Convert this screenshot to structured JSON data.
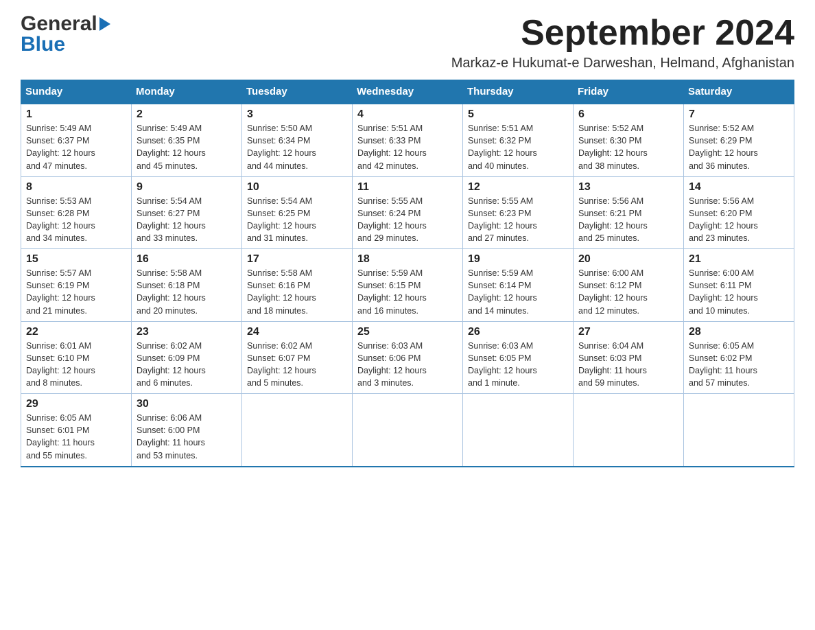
{
  "header": {
    "logo_line1": "General",
    "logo_line2": "Blue",
    "title": "September 2024",
    "subtitle": "Markaz-e Hukumat-e Darweshan, Helmand, Afghanistan"
  },
  "weekdays": [
    "Sunday",
    "Monday",
    "Tuesday",
    "Wednesday",
    "Thursday",
    "Friday",
    "Saturday"
  ],
  "weeks": [
    [
      {
        "day": "1",
        "info": "Sunrise: 5:49 AM\nSunset: 6:37 PM\nDaylight: 12 hours\nand 47 minutes."
      },
      {
        "day": "2",
        "info": "Sunrise: 5:49 AM\nSunset: 6:35 PM\nDaylight: 12 hours\nand 45 minutes."
      },
      {
        "day": "3",
        "info": "Sunrise: 5:50 AM\nSunset: 6:34 PM\nDaylight: 12 hours\nand 44 minutes."
      },
      {
        "day": "4",
        "info": "Sunrise: 5:51 AM\nSunset: 6:33 PM\nDaylight: 12 hours\nand 42 minutes."
      },
      {
        "day": "5",
        "info": "Sunrise: 5:51 AM\nSunset: 6:32 PM\nDaylight: 12 hours\nand 40 minutes."
      },
      {
        "day": "6",
        "info": "Sunrise: 5:52 AM\nSunset: 6:30 PM\nDaylight: 12 hours\nand 38 minutes."
      },
      {
        "day": "7",
        "info": "Sunrise: 5:52 AM\nSunset: 6:29 PM\nDaylight: 12 hours\nand 36 minutes."
      }
    ],
    [
      {
        "day": "8",
        "info": "Sunrise: 5:53 AM\nSunset: 6:28 PM\nDaylight: 12 hours\nand 34 minutes."
      },
      {
        "day": "9",
        "info": "Sunrise: 5:54 AM\nSunset: 6:27 PM\nDaylight: 12 hours\nand 33 minutes."
      },
      {
        "day": "10",
        "info": "Sunrise: 5:54 AM\nSunset: 6:25 PM\nDaylight: 12 hours\nand 31 minutes."
      },
      {
        "day": "11",
        "info": "Sunrise: 5:55 AM\nSunset: 6:24 PM\nDaylight: 12 hours\nand 29 minutes."
      },
      {
        "day": "12",
        "info": "Sunrise: 5:55 AM\nSunset: 6:23 PM\nDaylight: 12 hours\nand 27 minutes."
      },
      {
        "day": "13",
        "info": "Sunrise: 5:56 AM\nSunset: 6:21 PM\nDaylight: 12 hours\nand 25 minutes."
      },
      {
        "day": "14",
        "info": "Sunrise: 5:56 AM\nSunset: 6:20 PM\nDaylight: 12 hours\nand 23 minutes."
      }
    ],
    [
      {
        "day": "15",
        "info": "Sunrise: 5:57 AM\nSunset: 6:19 PM\nDaylight: 12 hours\nand 21 minutes."
      },
      {
        "day": "16",
        "info": "Sunrise: 5:58 AM\nSunset: 6:18 PM\nDaylight: 12 hours\nand 20 minutes."
      },
      {
        "day": "17",
        "info": "Sunrise: 5:58 AM\nSunset: 6:16 PM\nDaylight: 12 hours\nand 18 minutes."
      },
      {
        "day": "18",
        "info": "Sunrise: 5:59 AM\nSunset: 6:15 PM\nDaylight: 12 hours\nand 16 minutes."
      },
      {
        "day": "19",
        "info": "Sunrise: 5:59 AM\nSunset: 6:14 PM\nDaylight: 12 hours\nand 14 minutes."
      },
      {
        "day": "20",
        "info": "Sunrise: 6:00 AM\nSunset: 6:12 PM\nDaylight: 12 hours\nand 12 minutes."
      },
      {
        "day": "21",
        "info": "Sunrise: 6:00 AM\nSunset: 6:11 PM\nDaylight: 12 hours\nand 10 minutes."
      }
    ],
    [
      {
        "day": "22",
        "info": "Sunrise: 6:01 AM\nSunset: 6:10 PM\nDaylight: 12 hours\nand 8 minutes."
      },
      {
        "day": "23",
        "info": "Sunrise: 6:02 AM\nSunset: 6:09 PM\nDaylight: 12 hours\nand 6 minutes."
      },
      {
        "day": "24",
        "info": "Sunrise: 6:02 AM\nSunset: 6:07 PM\nDaylight: 12 hours\nand 5 minutes."
      },
      {
        "day": "25",
        "info": "Sunrise: 6:03 AM\nSunset: 6:06 PM\nDaylight: 12 hours\nand 3 minutes."
      },
      {
        "day": "26",
        "info": "Sunrise: 6:03 AM\nSunset: 6:05 PM\nDaylight: 12 hours\nand 1 minute."
      },
      {
        "day": "27",
        "info": "Sunrise: 6:04 AM\nSunset: 6:03 PM\nDaylight: 11 hours\nand 59 minutes."
      },
      {
        "day": "28",
        "info": "Sunrise: 6:05 AM\nSunset: 6:02 PM\nDaylight: 11 hours\nand 57 minutes."
      }
    ],
    [
      {
        "day": "29",
        "info": "Sunrise: 6:05 AM\nSunset: 6:01 PM\nDaylight: 11 hours\nand 55 minutes."
      },
      {
        "day": "30",
        "info": "Sunrise: 6:06 AM\nSunset: 6:00 PM\nDaylight: 11 hours\nand 53 minutes."
      },
      {
        "day": "",
        "info": ""
      },
      {
        "day": "",
        "info": ""
      },
      {
        "day": "",
        "info": ""
      },
      {
        "day": "",
        "info": ""
      },
      {
        "day": "",
        "info": ""
      }
    ]
  ]
}
